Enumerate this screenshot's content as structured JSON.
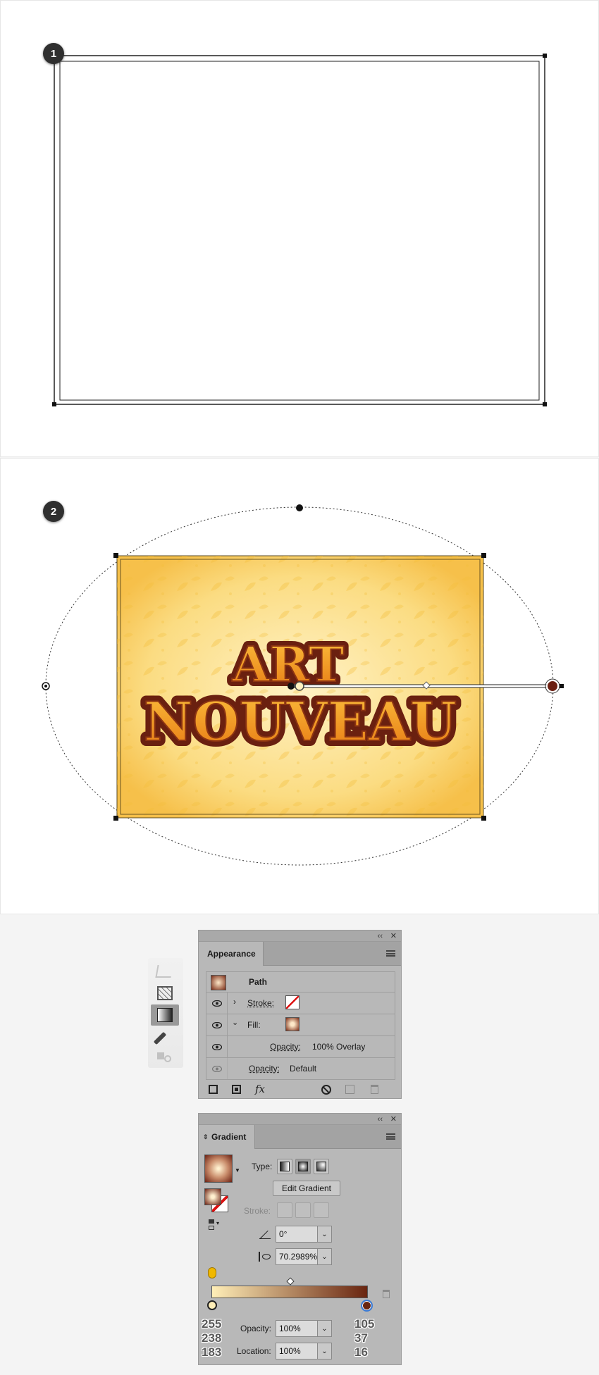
{
  "steps": {
    "step1": "1",
    "step2": "2"
  },
  "artwork": {
    "line1": "ART",
    "line2": "NOUVEAU"
  },
  "colors": {
    "accent": "#7a2a14",
    "bg_yellow": "#f9d36b",
    "text_orange": "#f2a023"
  },
  "tools": [
    "perspective-grid-icon",
    "mesh-icon",
    "gradient-icon",
    "eyedropper-icon",
    "shape-builder-icon"
  ],
  "appearance": {
    "tab": "Appearance",
    "object": "Path",
    "stroke_label": "Stroke:",
    "fill_label": "Fill:",
    "fill_opacity_label": "Opacity:",
    "fill_opacity_value": "100% Overlay",
    "opacity_label": "Opacity:",
    "opacity_value": "Default",
    "footer_icons": [
      "add-stroke-icon",
      "add-fill-icon",
      "fx-icon",
      "clear-appearance-icon",
      "duplicate-item-icon",
      "delete-item-icon"
    ]
  },
  "gradient": {
    "tab": "Gradient",
    "type_label": "Type:",
    "edit_button": "Edit Gradient",
    "stroke_label": "Stroke:",
    "angle": "0°",
    "aspect": "70.2989%",
    "opacity_label": "Opacity:",
    "opacity_value": "100%",
    "location_label": "Location:",
    "location_value": "100%",
    "start_rgb": [
      "255",
      "238",
      "183"
    ],
    "end_rgb": [
      "105",
      "37",
      "16"
    ]
  }
}
